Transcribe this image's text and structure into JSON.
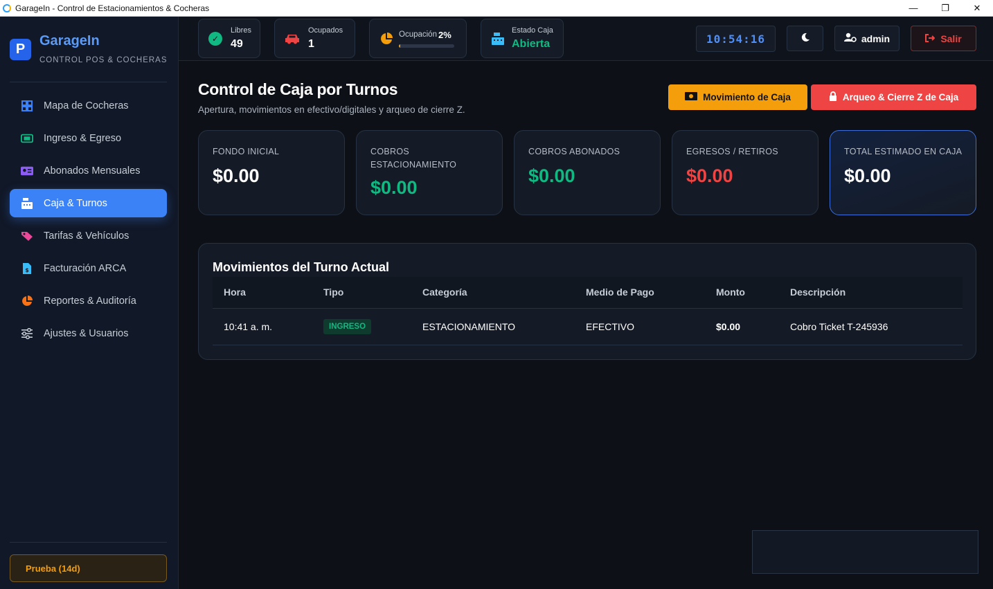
{
  "window": {
    "title": "GarageIn - Control de Estacionamientos & Cocheras",
    "minimize": "—",
    "maximize": "❐",
    "close": "✕"
  },
  "brand": {
    "logo": "P",
    "name": "GarageIn",
    "subtitle": "CONTROL POS & COCHERAS"
  },
  "sidebar": {
    "items": [
      {
        "label": "Mapa de Cocheras",
        "icon": "grid-icon",
        "color": "#3b82f6"
      },
      {
        "label": "Ingreso & Egreso",
        "icon": "ticket-icon",
        "color": "#10b981"
      },
      {
        "label": "Abonados Mensuales",
        "icon": "id-card-icon",
        "color": "#8b5cf6"
      },
      {
        "label": "Caja & Turnos",
        "icon": "cash-register-icon",
        "color": "#ffffff",
        "active": true
      },
      {
        "label": "Tarifas & Vehículos",
        "icon": "tag-icon",
        "color": "#ec4899"
      },
      {
        "label": "Facturación ARCA",
        "icon": "invoice-icon",
        "color": "#38bdf8"
      },
      {
        "label": "Reportes & Auditoría",
        "icon": "pie-chart-icon",
        "color": "#f97316"
      },
      {
        "label": "Ajustes & Usuarios",
        "icon": "sliders-icon",
        "color": "#c7cdd6"
      }
    ],
    "trial": "Prueba (14d)"
  },
  "topbar": {
    "free": {
      "label": "Libres",
      "value": "49",
      "color": "#10b981"
    },
    "occupied": {
      "label": "Ocupados",
      "value": "1",
      "color": "#ef4444"
    },
    "occupancy": {
      "label": "Ocupación",
      "value": "2%",
      "percent": 2,
      "color": "#f59e0b"
    },
    "cash_state": {
      "label": "Estado Caja",
      "value": "Abierta",
      "color": "#10b981"
    },
    "clock": "10:54:16",
    "user": "admin",
    "logout": "Salir"
  },
  "main": {
    "title": "Control de Caja por Turnos",
    "subtitle": "Apertura, movimientos en efectivo/digitales y arqueo de cierre Z.",
    "btn_movement": "Movimiento de Caja",
    "btn_close": "Arqueo & Cierre Z de Caja",
    "stats": [
      {
        "label": "FONDO INICIAL",
        "value": "$0.00",
        "color": "#ffffff"
      },
      {
        "label": "COBROS ESTACIONAMIENTO",
        "value": "$0.00",
        "color": "#10b981"
      },
      {
        "label": "COBROS ABONADOS",
        "value": "$0.00",
        "color": "#10b981"
      },
      {
        "label": "EGRESOS / RETIROS",
        "value": "$0.00",
        "color": "#ef4444"
      },
      {
        "label": "TOTAL ESTIMADO EN CAJA",
        "value": "$0.00",
        "color": "#ffffff"
      }
    ],
    "movements": {
      "title": "Movimientos del Turno Actual",
      "columns": [
        "Hora",
        "Tipo",
        "Categoría",
        "Medio de Pago",
        "Monto",
        "Descripción"
      ],
      "rows": [
        {
          "hora": "10:41 a. m.",
          "tipo": "INGRESO",
          "categoria": "ESTACIONAMIENTO",
          "medio": "EFECTIVO",
          "monto": "$0.00",
          "descripcion": "Cobro Ticket T-245936"
        }
      ]
    }
  }
}
